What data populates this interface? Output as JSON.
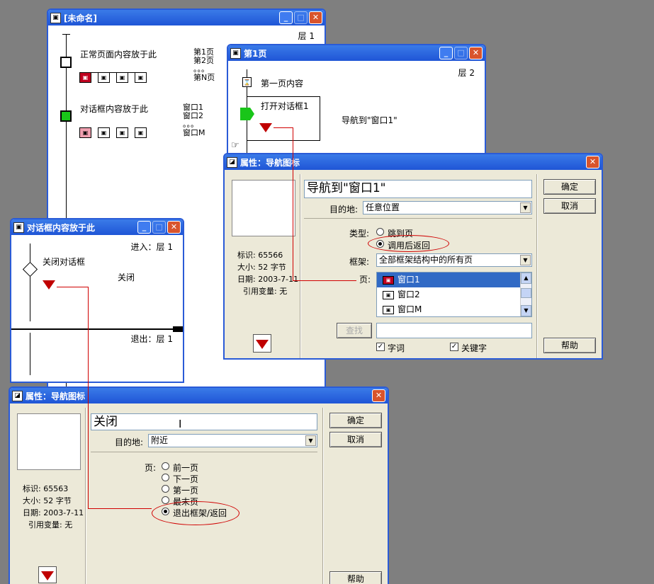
{
  "win_main": {
    "title": "[未命名]",
    "level": "层 1",
    "pages_label": "正常页面内容放于此",
    "dialog_label": "对话框内容放于此",
    "page_list": [
      "第1页",
      "第2页",
      "。。。",
      "第N页"
    ],
    "window_list": [
      "窗口1",
      "窗口2",
      "。。。",
      "窗口M"
    ]
  },
  "win_page1": {
    "title": "第1页",
    "level": "层 2",
    "node1": "第一页内容",
    "node2": "打开对话框1",
    "nav_label": "导航到\"窗口1\""
  },
  "win_dialog": {
    "title": "对话框内容放于此",
    "enter_level": "进入：层 1",
    "exit_level": "退出：层 1",
    "node1": "关闭对话框",
    "nav_label": "关闭"
  },
  "dlg1": {
    "title": "属性：导航图标",
    "name_value": "导航到\"窗口1\"",
    "dest_label": "目的地:",
    "dest_value": "任意位置",
    "type_label": "类型:",
    "type_opt1": "跳到页",
    "type_opt2": "调用后返回",
    "frame_label": "框架:",
    "frame_value": "全部框架结构中的所有页",
    "page_label": "页:",
    "pages": [
      "窗口1",
      "窗口2",
      "窗口M"
    ],
    "find_btn": "查找",
    "chk1": "字词",
    "chk2": "关键字",
    "ok": "确定",
    "cancel": "取消",
    "help": "帮助",
    "id": "标识: 65566",
    "size": "大小: 52 字节",
    "date": "日期: 2003-7-11",
    "ref": "引用变量: 无"
  },
  "dlg2": {
    "title": "属性：导航图标",
    "name_value": "关闭",
    "dest_label": "目的地:",
    "dest_value": "附近",
    "page_label": "页:",
    "opts": [
      "前一页",
      "下一页",
      "第一页",
      "最末页",
      "退出框架/返回"
    ],
    "ok": "确定",
    "cancel": "取消",
    "help": "帮助",
    "id": "标识: 65563",
    "size": "大小: 52 字节",
    "date": "日期: 2003-7-11",
    "ref": "引用变量: 无"
  },
  "colors": {
    "titlebar": "#1f55d6",
    "accent_red": "#d00000",
    "desktop": "#7f7f7f"
  }
}
